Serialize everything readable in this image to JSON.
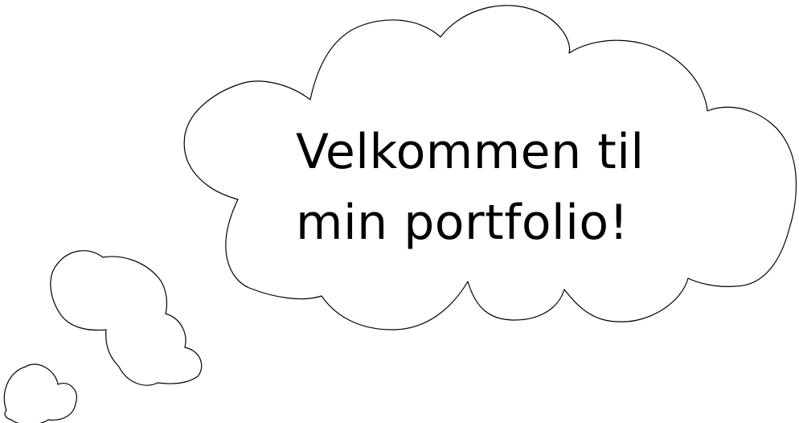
{
  "message": {
    "line1": "Velkommen til",
    "line2": "min portfolio!"
  },
  "colors": {
    "background": "#ffffff",
    "outline": "#000000",
    "text": "#000000"
  }
}
